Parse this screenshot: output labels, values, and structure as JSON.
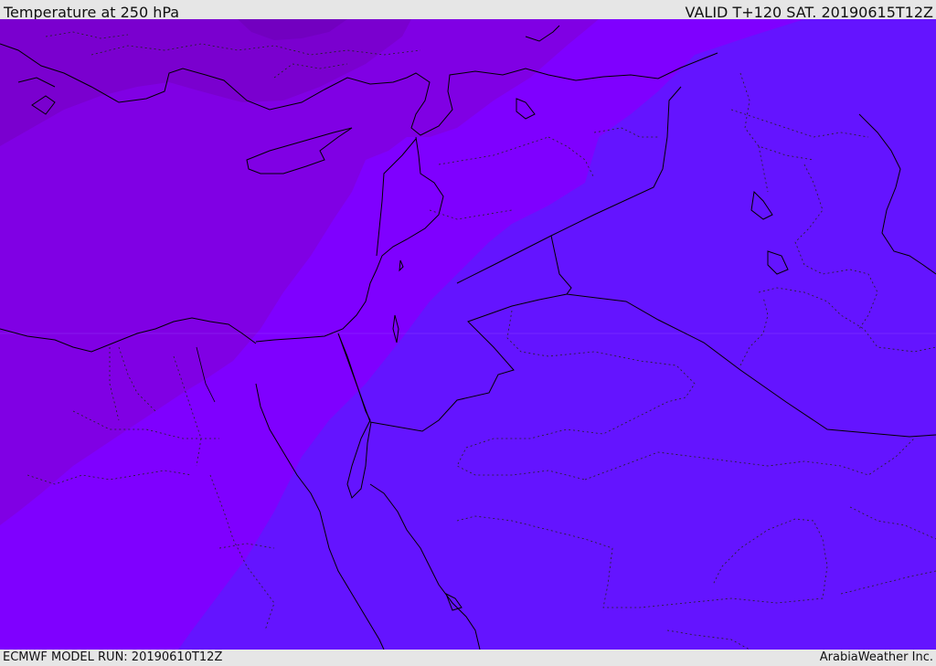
{
  "header": {
    "title": "Temperature at 250 hPa",
    "valid_time": "VALID T+120 SAT. 20190615T12Z"
  },
  "footer": {
    "model_run": "ECMWF MODEL RUN: 20190610T12Z",
    "credit": "ArabiaWeather Inc."
  },
  "map": {
    "region": "Eastern Mediterranean / Middle East",
    "colors": {
      "band_darkest": "#7a00cf",
      "band_dark": "#8000e4",
      "band_mid": "#7f00ff",
      "band_light": "#6414ff",
      "coastline": "#000000",
      "border_dotted": "#333333"
    }
  }
}
